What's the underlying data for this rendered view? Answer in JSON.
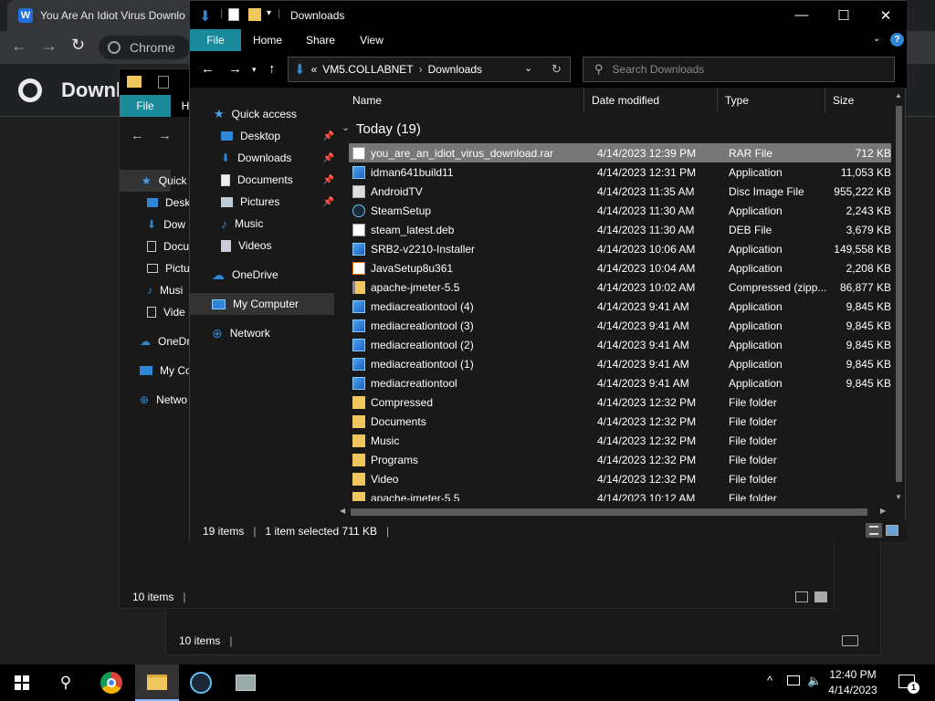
{
  "chrome": {
    "tab_title": "You Are An Idiot Virus Downlo",
    "omnibox_label": "Chrome",
    "page_heading": "Downl"
  },
  "back_explorer": {
    "ribbon_file": "File",
    "ribbon_h": "H",
    "nav": [
      "Quick",
      "Desk",
      "Dow",
      "Docu",
      "Pictu",
      "Musi",
      "Vide",
      "OneDr",
      "My Co",
      "Netwo"
    ],
    "status_items": "10 items"
  },
  "back_explorer2": {
    "status_items": "10 items"
  },
  "explorer": {
    "title": "Downloads",
    "ribbon": {
      "file": "File",
      "home": "Home",
      "share": "Share",
      "view": "View"
    },
    "address": {
      "prefix": "«",
      "segment1": "VM5.COLLABNET",
      "segment2": "Downloads"
    },
    "search_placeholder": "Search Downloads",
    "nav": {
      "quick_access": "Quick access",
      "desktop": "Desktop",
      "downloads": "Downloads",
      "documents": "Documents",
      "pictures": "Pictures",
      "music": "Music",
      "videos": "Videos",
      "onedrive": "OneDrive",
      "my_computer": "My Computer",
      "network": "Network"
    },
    "columns": {
      "name": "Name",
      "date": "Date modified",
      "type": "Type",
      "size": "Size"
    },
    "group_label": "Today (19)",
    "files": [
      {
        "name": "you_are_an_idiot_virus_download.rar",
        "date": "4/14/2023 12:39 PM",
        "type": "RAR File",
        "size": "712 KB",
        "icon": "rar-file-icon"
      },
      {
        "name": "idman641build11",
        "date": "4/14/2023 12:31 PM",
        "type": "Application",
        "size": "11,053 KB",
        "icon": "app-icon"
      },
      {
        "name": "AndroidTV",
        "date": "4/14/2023 11:35 AM",
        "type": "Disc Image File",
        "size": "955,222 KB",
        "icon": "disc-image-icon"
      },
      {
        "name": "SteamSetup",
        "date": "4/14/2023 11:30 AM",
        "type": "Application",
        "size": "2,243 KB",
        "icon": "steam-icon"
      },
      {
        "name": "steam_latest.deb",
        "date": "4/14/2023 11:30 AM",
        "type": "DEB File",
        "size": "3,679 KB",
        "icon": "file-icon"
      },
      {
        "name": "SRB2-v2210-Installer",
        "date": "4/14/2023 10:06 AM",
        "type": "Application",
        "size": "149,558 KB",
        "icon": "app-icon"
      },
      {
        "name": "JavaSetup8u361",
        "date": "4/14/2023 10:04 AM",
        "type": "Application",
        "size": "2,208 KB",
        "icon": "java-icon"
      },
      {
        "name": "apache-jmeter-5.5",
        "date": "4/14/2023 10:02 AM",
        "type": "Compressed (zipp...",
        "size": "86,877 KB",
        "icon": "zip-folder-icon"
      },
      {
        "name": "mediacreationtool (4)",
        "date": "4/14/2023 9:41 AM",
        "type": "Application",
        "size": "9,845 KB",
        "icon": "app-icon"
      },
      {
        "name": "mediacreationtool (3)",
        "date": "4/14/2023 9:41 AM",
        "type": "Application",
        "size": "9,845 KB",
        "icon": "app-icon"
      },
      {
        "name": "mediacreationtool (2)",
        "date": "4/14/2023 9:41 AM",
        "type": "Application",
        "size": "9,845 KB",
        "icon": "app-icon"
      },
      {
        "name": "mediacreationtool (1)",
        "date": "4/14/2023 9:41 AM",
        "type": "Application",
        "size": "9,845 KB",
        "icon": "app-icon"
      },
      {
        "name": "mediacreationtool",
        "date": "4/14/2023 9:41 AM",
        "type": "Application",
        "size": "9,845 KB",
        "icon": "app-icon"
      },
      {
        "name": "Compressed",
        "date": "4/14/2023 12:32 PM",
        "type": "File folder",
        "size": "",
        "icon": "folder-icon"
      },
      {
        "name": "Documents",
        "date": "4/14/2023 12:32 PM",
        "type": "File folder",
        "size": "",
        "icon": "folder-icon"
      },
      {
        "name": "Music",
        "date": "4/14/2023 12:32 PM",
        "type": "File folder",
        "size": "",
        "icon": "folder-icon"
      },
      {
        "name": "Programs",
        "date": "4/14/2023 12:32 PM",
        "type": "File folder",
        "size": "",
        "icon": "folder-icon"
      },
      {
        "name": "Video",
        "date": "4/14/2023 12:32 PM",
        "type": "File folder",
        "size": "",
        "icon": "folder-icon"
      },
      {
        "name": "apache-jmeter-5.5",
        "date": "4/14/2023 10:12 AM",
        "type": "File folder",
        "size": "",
        "icon": "folder-icon"
      }
    ],
    "status": {
      "count": "19 items",
      "selection": "1 item selected  711 KB"
    }
  },
  "taskbar": {
    "time": "12:40 PM",
    "date": "4/14/2023",
    "notification_count": "1"
  },
  "colors": {
    "accent": "#1e6fd9",
    "ribbon_file": "#1a8a9a",
    "folder": "#f0c75e",
    "selected_row": "#777777"
  }
}
